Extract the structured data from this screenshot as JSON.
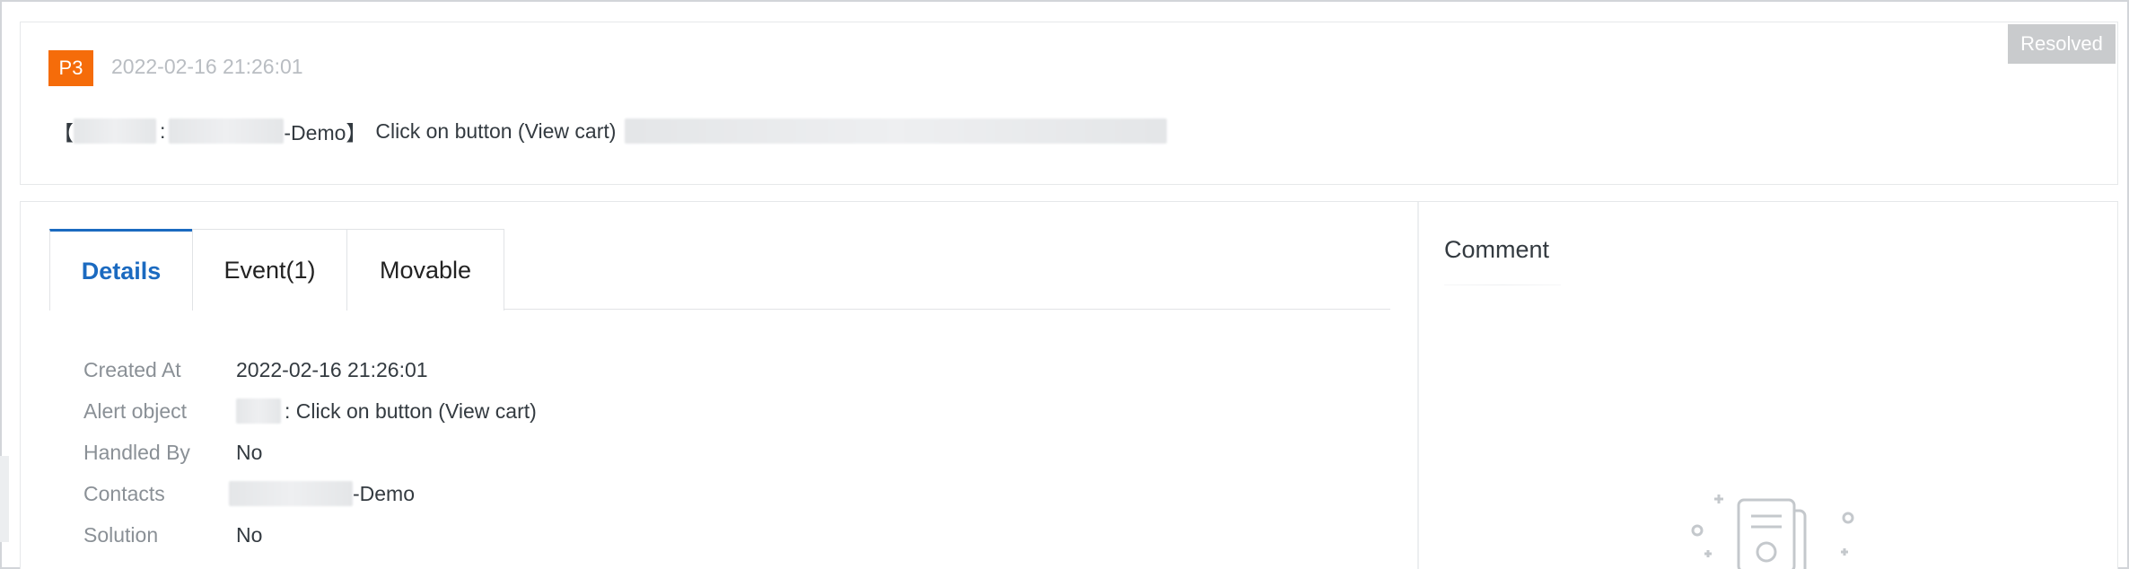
{
  "header": {
    "priority": "P3",
    "timestamp": "2022-02-16 21:26:01",
    "status": "Resolved",
    "alert": {
      "open_bracket": "【",
      "colon": ":",
      "app_suffix": "-Demo】",
      "message": "Click on button (View cart)"
    }
  },
  "tabs": [
    {
      "label": "Details",
      "active": true
    },
    {
      "label": "Event(1)",
      "active": false
    },
    {
      "label": "Movable",
      "active": false
    }
  ],
  "details": {
    "created_at": {
      "label": "Created At",
      "value": "2022-02-16 21:26:01"
    },
    "alert_object": {
      "label": "Alert object",
      "value": ": Click on button (View cart)"
    },
    "handled_by": {
      "label": "Handled By",
      "value": "No"
    },
    "contacts": {
      "label": "Contacts",
      "value": "-Demo"
    },
    "solution": {
      "label": "Solution",
      "value": "No"
    }
  },
  "comment": {
    "title": "Comment",
    "empty_icon": "empty-document-icon"
  },
  "colors": {
    "priority_bg": "#f56c0a",
    "status_bg": "#c9cbcd",
    "active_tab": "#1b6ac0"
  }
}
